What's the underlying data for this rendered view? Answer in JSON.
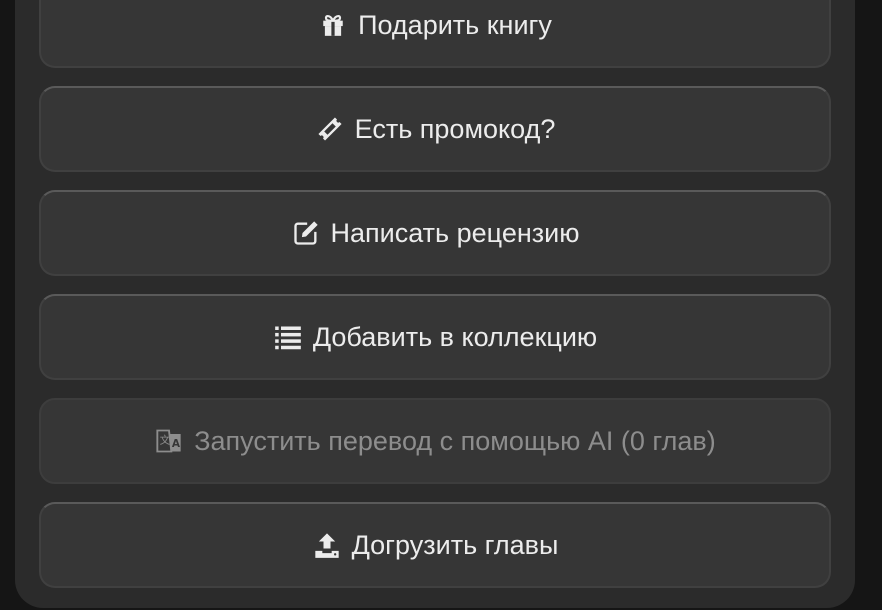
{
  "buttons": {
    "gift": {
      "label": "Подарить книгу",
      "icon": "gift-icon"
    },
    "promo": {
      "label": "Есть промокод?",
      "icon": "ticket-icon"
    },
    "review": {
      "label": "Написать рецензию",
      "icon": "edit-icon"
    },
    "collection": {
      "label": "Добавить в коллекцию",
      "icon": "list-icon"
    },
    "translate": {
      "label": "Запустить перевод с помощью AI (0 глав)",
      "icon": "translate-icon"
    },
    "upload": {
      "label": "Догрузить главы",
      "icon": "upload-icon"
    }
  }
}
